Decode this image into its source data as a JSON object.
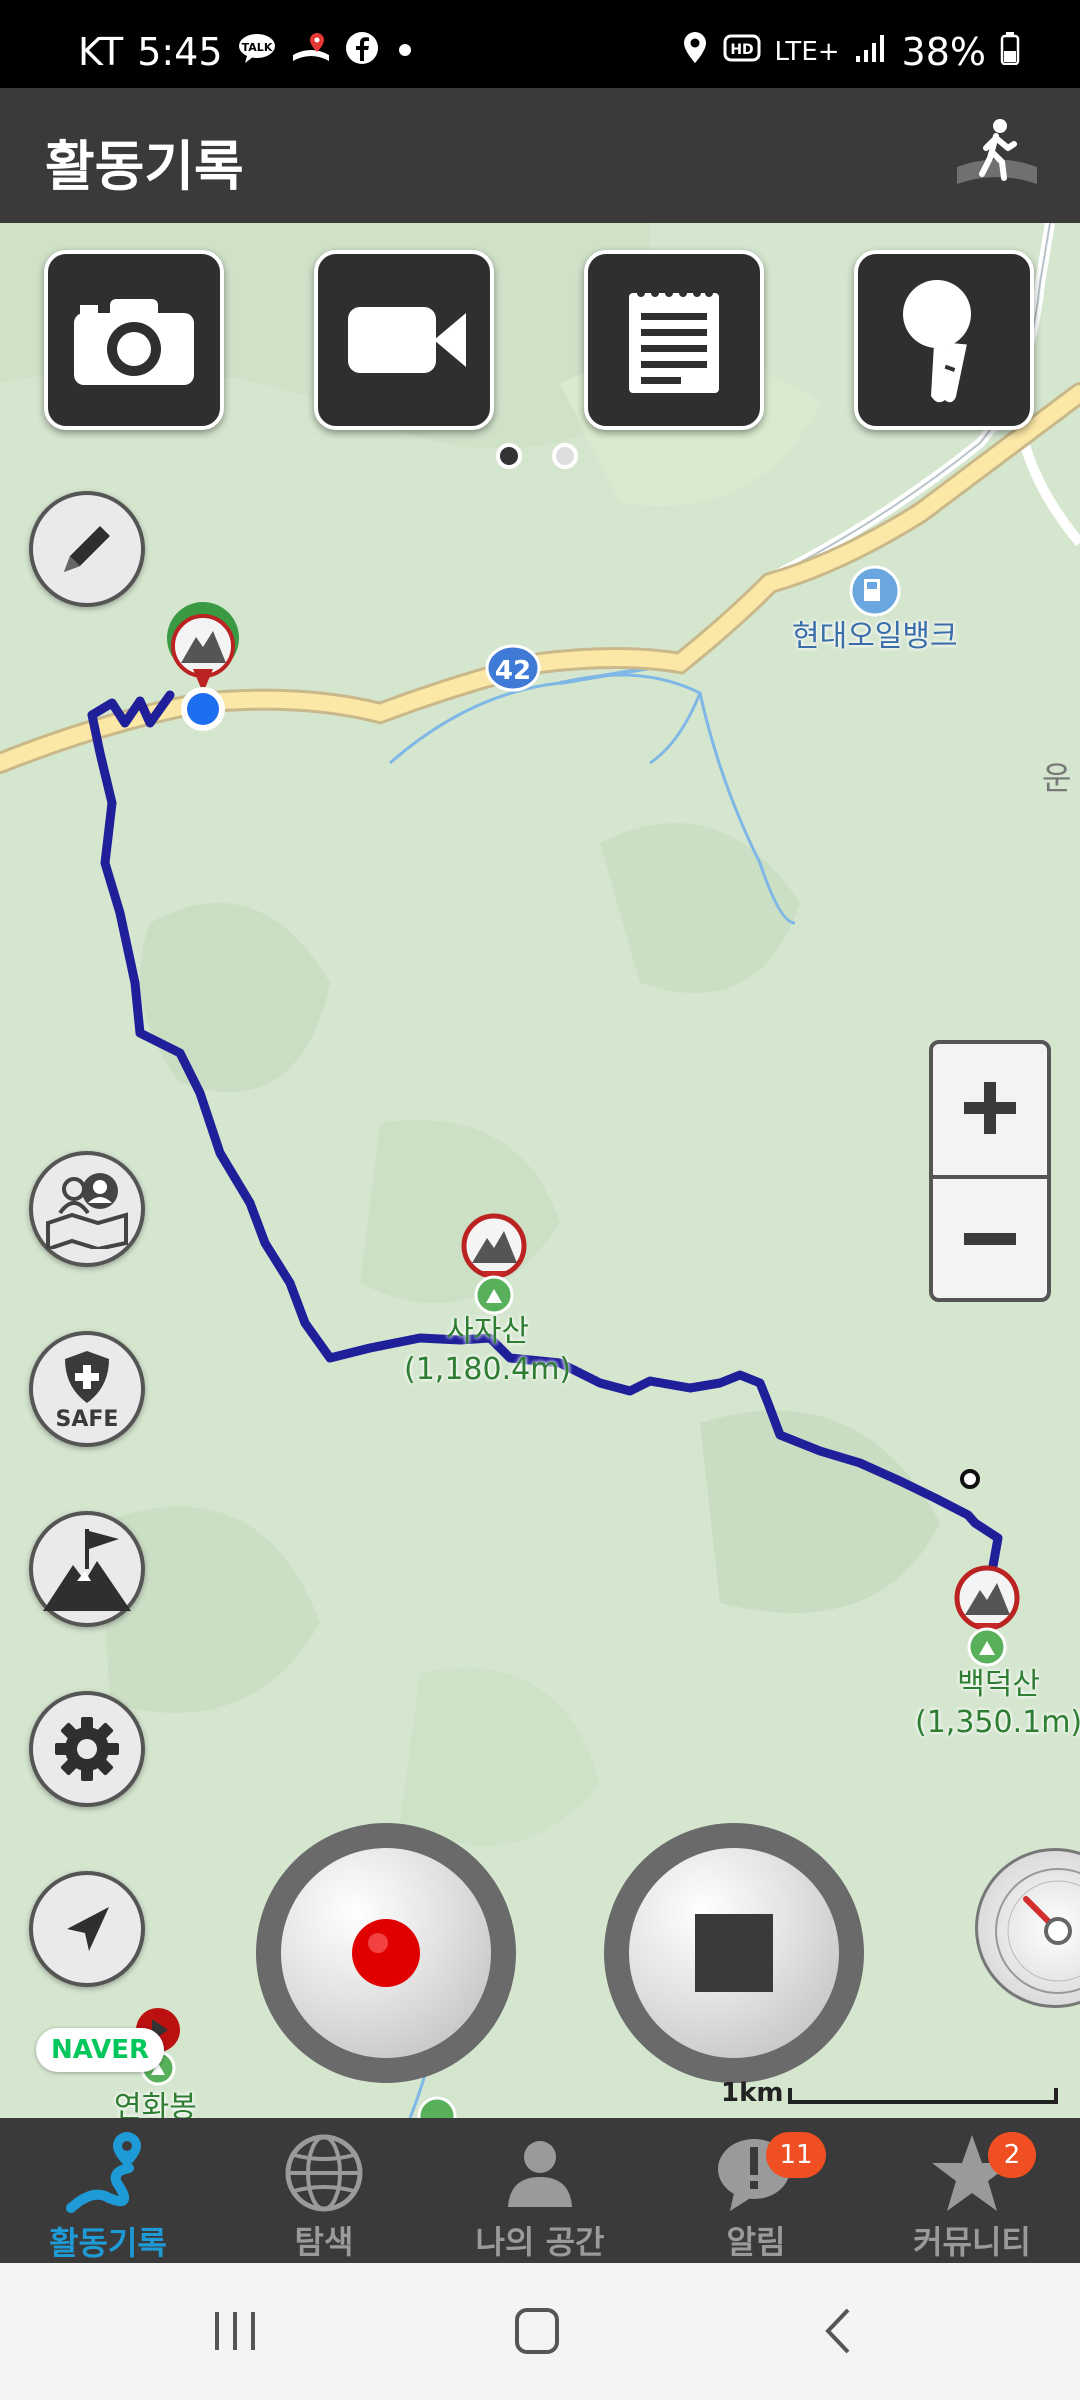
{
  "status_bar": {
    "carrier": "KT",
    "time": "5:45",
    "notification_icons": [
      "talk-icon",
      "map-pin-icon",
      "facebook-icon",
      "dot-icon"
    ],
    "network": "LTE+",
    "battery": "38%"
  },
  "header": {
    "title": "활동기록",
    "action_icon": "walking-person-icon"
  },
  "toolbar": {
    "items": [
      {
        "name": "camera",
        "icon": "camera-icon"
      },
      {
        "name": "video",
        "icon": "video-camera-icon"
      },
      {
        "name": "memo",
        "icon": "notepad-icon"
      },
      {
        "name": "voice",
        "icon": "microphone-icon"
      }
    ],
    "page_indicator": {
      "current": 1,
      "total": 2
    }
  },
  "side_buttons": [
    "pencil-icon",
    "shared-map-icon",
    "safe-shield-icon",
    "summit-flag-icon",
    "gear-icon",
    "navigation-arrow-icon"
  ],
  "safe_label": "SAFE",
  "zoom": {
    "in": "+",
    "out": "−"
  },
  "map": {
    "road_number": "42",
    "poi_gas_station": "현대오일뱅크",
    "edge_label": "운",
    "peaks": [
      {
        "name": "사자산",
        "elevation": "(1,180.4m)"
      },
      {
        "name": "백덕산",
        "elevation": "(1,350.1m)"
      },
      {
        "name": "연화봉",
        "elevation": ""
      }
    ],
    "naver": "NAVER",
    "scale": "1km"
  },
  "controls": {
    "record": "record-button",
    "stop": "stop-button"
  },
  "tabs": [
    {
      "label": "활동기록",
      "icon": "route-pin-icon",
      "active": true,
      "badge": ""
    },
    {
      "label": "탐색",
      "icon": "globe-icon",
      "active": false,
      "badge": ""
    },
    {
      "label": "나의 공간",
      "icon": "person-icon",
      "active": false,
      "badge": ""
    },
    {
      "label": "알림",
      "icon": "alert-bubble-icon",
      "active": false,
      "badge": "11"
    },
    {
      "label": "커뮤니티",
      "icon": "star-icon",
      "active": false,
      "badge": "2"
    }
  ],
  "colors": {
    "track": "#1f1f9a",
    "active_tab": "#1e9bd7",
    "badge": "#f04e23",
    "record": "#e00000",
    "peak_label": "#2e7d32"
  }
}
